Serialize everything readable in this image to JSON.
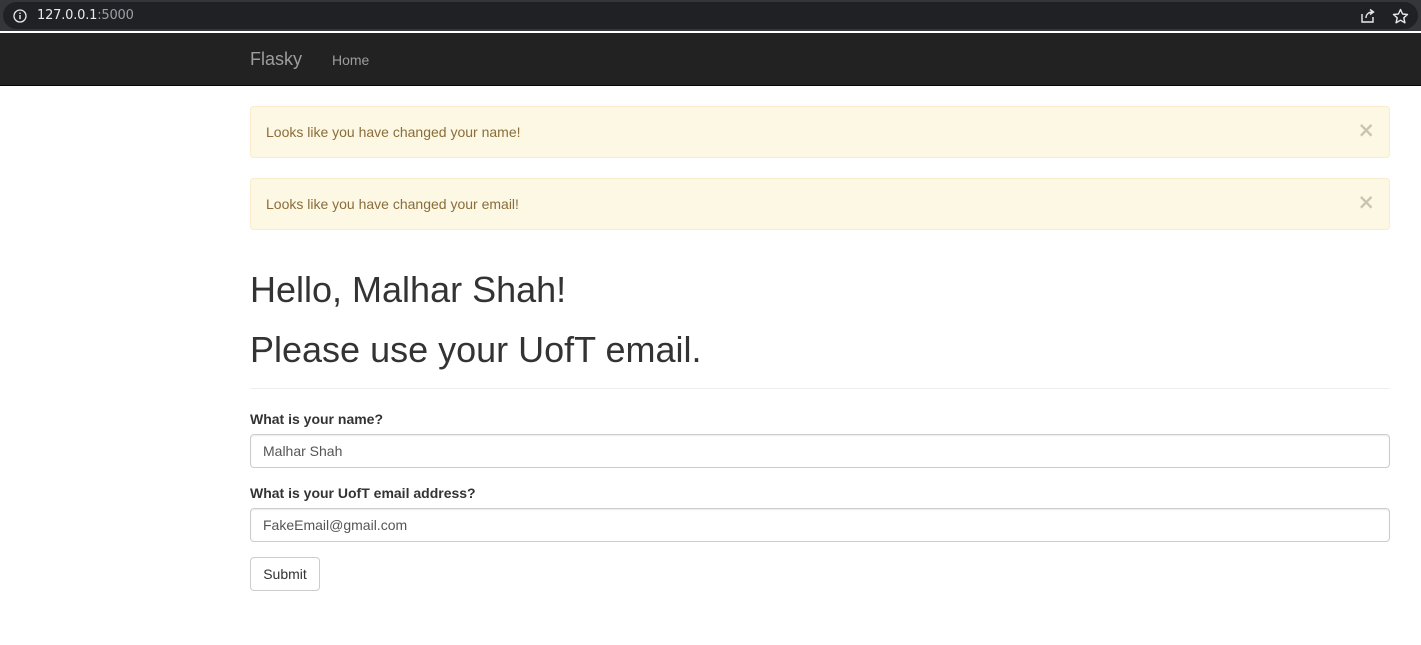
{
  "browser": {
    "url_host": "127.0.0.1",
    "url_port": ":5000",
    "icons": [
      "info-icon",
      "share-icon",
      "star-icon"
    ]
  },
  "navbar": {
    "brand": "Flasky",
    "items": [
      {
        "label": "Home"
      }
    ],
    "background": "#222222",
    "link_color": "#9d9d9d"
  },
  "alerts": [
    {
      "message": "Looks like you have changed your name!",
      "close": "×"
    },
    {
      "message": "Looks like you have changed your email!",
      "close": "×"
    }
  ],
  "alert_colors": {
    "background": "#fcf8e3",
    "border": "#faebcc",
    "text": "#8a6d3b"
  },
  "main": {
    "greeting": "Hello, Malhar Shah!",
    "notice": "Please use your UofT email."
  },
  "form": {
    "name_label": "What is your name?",
    "name_value": "Malhar Shah",
    "email_label": "What is your UofT email address?",
    "email_value": "FakeEmail@gmail.com",
    "submit_label": "Submit"
  }
}
